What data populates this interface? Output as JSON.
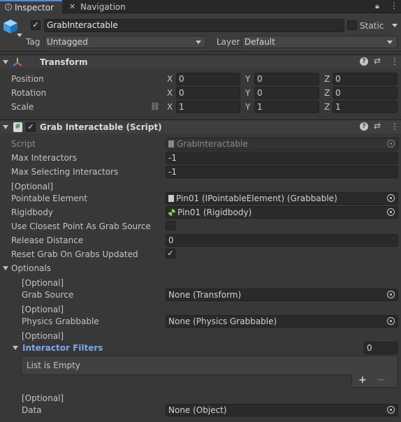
{
  "tabs": {
    "inspector": "Inspector",
    "navigation": "Navigation"
  },
  "header": {
    "object_name": "GrabInteractable",
    "static_label": "Static",
    "tag_label": "Tag",
    "tag_value": "Untagged",
    "layer_label": "Layer",
    "layer_value": "Default"
  },
  "transform": {
    "title": "Transform",
    "rows": [
      {
        "label": "Position",
        "x": "0",
        "y": "0",
        "z": "0"
      },
      {
        "label": "Rotation",
        "x": "0",
        "y": "0",
        "z": "0"
      },
      {
        "label": "Scale",
        "x": "1",
        "y": "1",
        "z": "1"
      }
    ],
    "axis": {
      "x": "X",
      "y": "Y",
      "z": "Z"
    }
  },
  "component": {
    "title": "Grab Interactable (Script)",
    "script_label": "Script",
    "script_value": "GrabInteractable",
    "max_interactors_label": "Max Interactors",
    "max_interactors_value": "-1",
    "max_selecting_label": "Max Selecting Interactors",
    "max_selecting_value": "-1",
    "optional_tag": "[Optional]",
    "pointable_label": "Pointable Element",
    "pointable_value": "Pin01 (IPointableElement) (Grabbable)",
    "rigidbody_label": "Rigidbody",
    "rigidbody_value": "Pin01 (Rigidbody)",
    "closest_point_label": "Use Closest Point As Grab Source",
    "release_distance_label": "Release Distance",
    "release_distance_value": "0",
    "reset_grab_label": "Reset Grab On Grabs Updated",
    "optionals_label": "Optionals",
    "grab_source_label": "Grab Source",
    "grab_source_value": "None (Transform)",
    "physics_grabbable_label": "Physics Grabbable",
    "physics_grabbable_value": "None (Physics Grabbable)",
    "interactor_filters_label": "Interactor Filters",
    "interactor_filters_count": "0",
    "list_empty": "List is Empty",
    "add_symbol": "+",
    "remove_symbol": "−",
    "data_label": "Data",
    "data_value": "None (Object)"
  },
  "colors": {
    "accent_blue": "#7aa7f0",
    "panel_bg": "#383838",
    "field_bg": "#2a2a2a"
  }
}
